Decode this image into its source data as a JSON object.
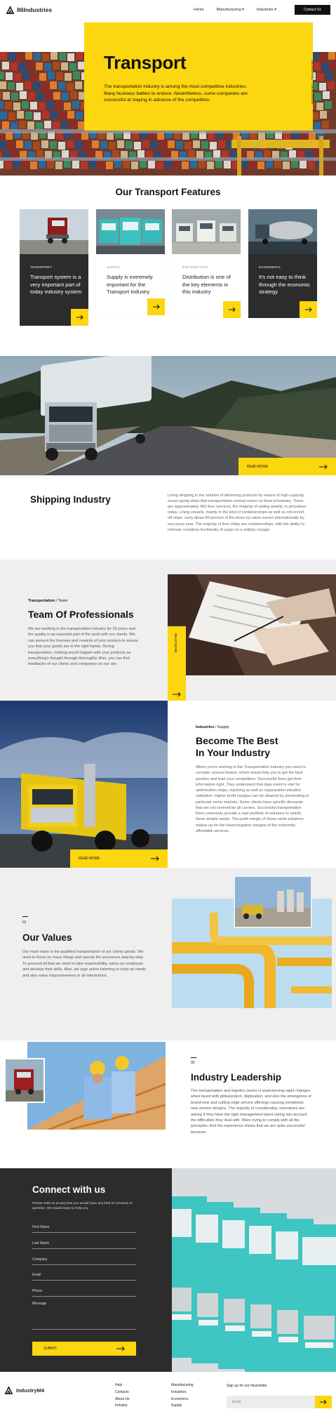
{
  "header": {
    "logo": "86Industries",
    "nav": [
      "Home",
      "Manufacturing",
      "Industries"
    ],
    "contact_button": "Contact Us"
  },
  "hero": {
    "title": "Transport",
    "text": "The transportation industry is among the most competitive industries. Many business battles to endure. Nevertheless, some companies are successful at staying in advance of the competition.",
    "side_label": "INDUSTRIES / TRANSPORT"
  },
  "features": {
    "title": "Our Transport Features",
    "cards": [
      {
        "label": "TRANSPORT",
        "text": "Transport system is a very important part of today industry system"
      },
      {
        "label": "SUPPLY",
        "text": "Supply is extremely important for the Transport Industry"
      },
      {
        "label": "DISTRIBUTION",
        "text": "Distribution is one of the key elements in this industry"
      },
      {
        "label": "ECONOMICS",
        "text": "It's not easy to think through the economic strategy"
      }
    ]
  },
  "banner": {
    "read_more": "READ MORE"
  },
  "shipping": {
    "title": "Shipping Industry",
    "text": "Lining shipping is the solution of delivering products by means of high-capacity, ocean-going ships that transportation normal routes on fixed schedules. There are approximately 400 liner services, the majority of sailing weekly, in procedure today. Lining vessels, mainly in the kind of containerships as well as roll-on/roll-off ships, carry about 60 percent of the items by value moved internationally by sea every year. The majority of liner ships are containerships, with the ability to relocate countless truckloads of cargo on a solitary voyage."
  },
  "team": {
    "crumb_bold": "Transportation",
    "crumb_rest": " / Team",
    "title": "Team Of Professionals",
    "text": "We are working in the transportation industry for 20 years and the quality is an essential part of the work with our clients. We can present the licenses and rewards of your workers to assure you that your goods are in the right hands. During transportation, nothing would happen with your products as everything's thought through thoroughly. Also, you can find feedbacks of our clients and companies on our site.",
    "side": "READ MORE"
  },
  "become": {
    "crumb_bold": "Industries",
    "crumb_rest": " / Supply",
    "title_line1": "Become The Best",
    "title_line2": "In Your Industry",
    "text": "When you're working in the Transportation Industry you need to consider several factors, which would help you to get the best position and lead your competitors. Successful firms get their information right. They understand that data event is vital for optimization steps, reporting as well as organization situation validation. Higher profit margins can be attained by penetrating in particular niche markets. Some clients have specific demands that are not covered by all carriers. Successful transportation firms commonly provide a vast portfolio of solutions to satisfy these details needs. The profit margin of those niche solutions makes up for the lower/negative margins of the extremely affordable services.",
    "read_more": "READ MORE"
  },
  "values": {
    "num": "01",
    "title": "Our Values",
    "text": "Our main value is the qualified transportation of our clients goods. We need to focus on many things and specify the processes step-by-step. To proceed all that we need to take responsibility, value our employee and develop their skills. Also, we urge active listening to clear up needs and also value responsiveness in all interactions."
  },
  "leadership": {
    "num": "02",
    "title": "Industry Leadership",
    "text": "The transportation and logistics sector is experiencing rapid changes when faced with globalization, digitization, and also the emergence of brand-new and cutting-edge service offerings causing completely new service designs. The majority of considerably, executives are asking if they have the right management talent taking into account the difficulties they deal with. Were trying to comply with all the principles. And the experience shows that we are quite successful because."
  },
  "connect": {
    "title": "Connect with us",
    "text": "Please write us at any time you would have any kind of concerns or question. We would enjoy to help you.",
    "fields": [
      "First Name",
      "Last Name",
      "Company",
      "Email",
      "Phone",
      "Message"
    ],
    "submit": "SUBMIT"
  },
  "footer": {
    "logo": "IndustryM4",
    "col1": [
      "Help",
      "Contacts",
      "About Us",
      "Industry"
    ],
    "col2": [
      "Manufacturing",
      "Industries",
      "Economics",
      "Supply"
    ],
    "newsletter_label": "Sign up for our Newsletter",
    "email_placeholder": "Email"
  },
  "colors": {
    "accent": "#fcd60f",
    "dark": "#2c2c2c",
    "light_bg": "#efefef"
  }
}
